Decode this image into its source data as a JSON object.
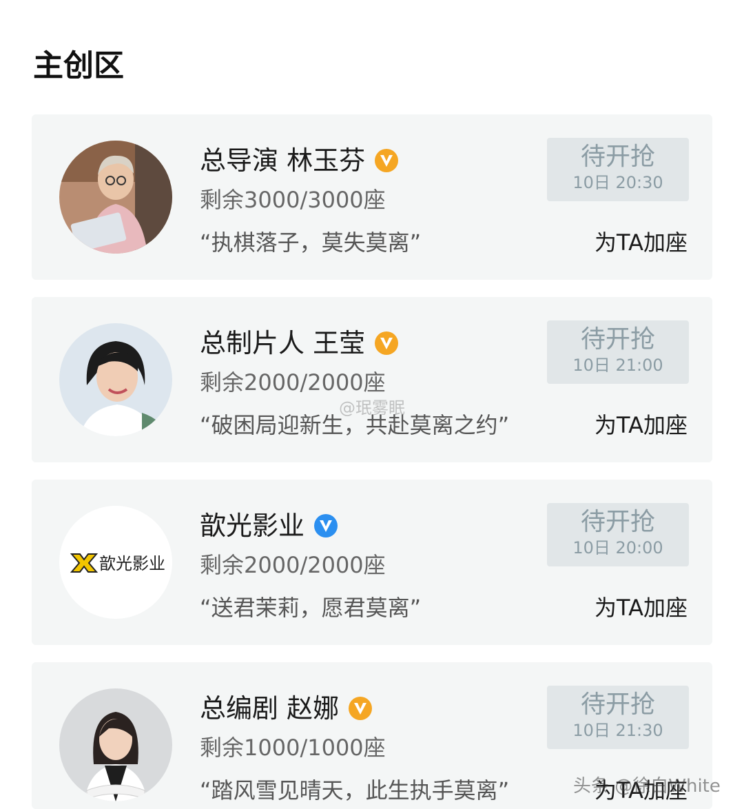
{
  "section_title": "主创区",
  "cards": [
    {
      "name": "总导演 林玉芬",
      "badge_color": "#f5a623",
      "seats": "剩余3000/3000座",
      "quote": "“执棋落子，莫失莫离”",
      "button_label": "待开抢",
      "button_time": "10日 20:30",
      "add_seat_label": "为TA加座",
      "avatar_icon": "person-photo-icon"
    },
    {
      "name": "总制片人 王莹",
      "badge_color": "#f5a623",
      "seats": "剩余2000/2000座",
      "quote": "“破困局迎新生，共赴莫离之约”",
      "button_label": "待开抢",
      "button_time": "10日 21:00",
      "add_seat_label": "为TA加座",
      "avatar_icon": "person-photo-icon"
    },
    {
      "name": "歆光影业",
      "badge_color": "#2b8ff0",
      "seats": "剩余2000/2000座",
      "quote": "“送君茉莉，愿君莫离”",
      "button_label": "待开抢",
      "button_time": "10日 20:00",
      "add_seat_label": "为TA加座",
      "avatar_icon": "company-logo-icon",
      "logo_text": "歆光影业"
    },
    {
      "name": "总编剧 赵娜",
      "badge_color": "#f5a623",
      "seats": "剩余1000/1000座",
      "quote": "“踏风雪见晴天，此生执手莫离”",
      "button_label": "待开抢",
      "button_time": "10日 21:30",
      "add_seat_label": "为TA加座",
      "avatar_icon": "person-photo-icon"
    }
  ],
  "watermarks": {
    "weibo": "@珉雾眠",
    "toutiao": "头条 @徐白White"
  }
}
